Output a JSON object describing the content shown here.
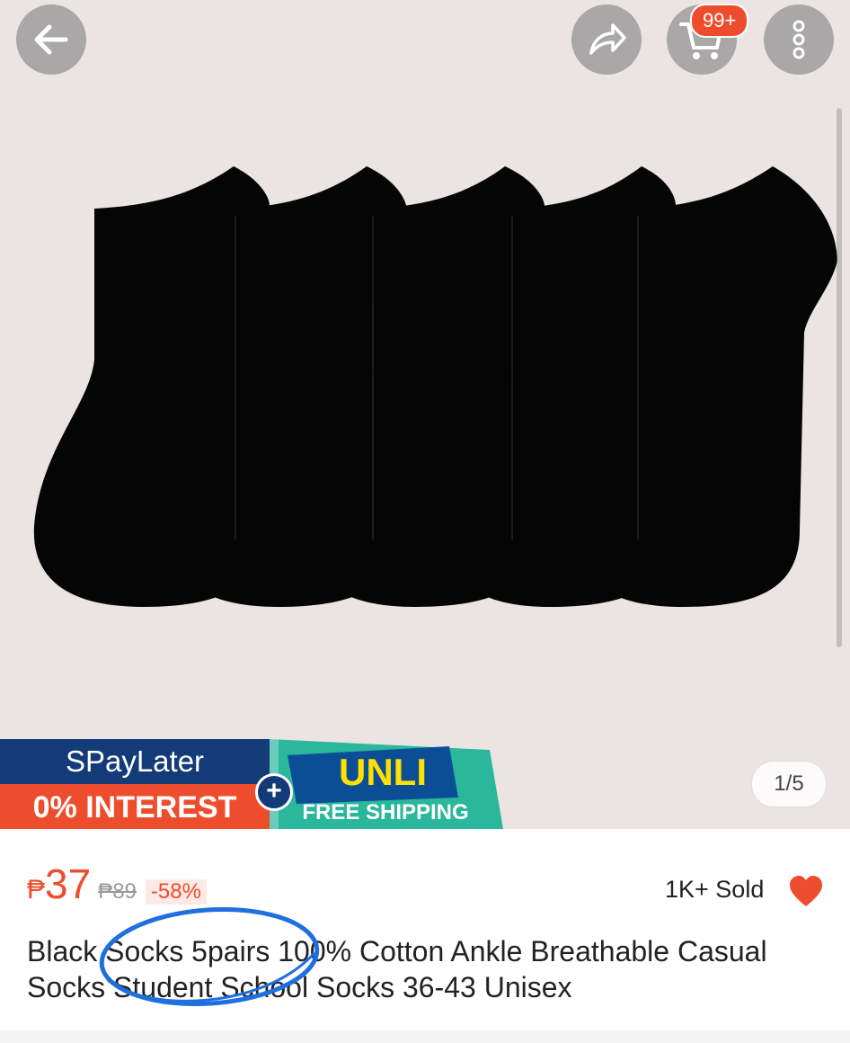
{
  "header": {
    "back_icon": "arrow-left-icon",
    "share_icon": "share-arrow-icon",
    "cart_icon": "shopping-cart-icon",
    "cart_badge": "99+",
    "more_icon": "more-vertical-icon"
  },
  "gallery": {
    "counter": "1/5",
    "image_subject": "five black ankle socks"
  },
  "banner": {
    "spaylater": "SPayLater",
    "interest": "0% INTEREST",
    "unli": "UNLI",
    "free_shipping": "FREE SHIPPING"
  },
  "product": {
    "currency": "₱",
    "price": "37",
    "original_price": "₱89",
    "discount": "-58%",
    "sold": "1K+ Sold",
    "title": "Black Socks 5pairs 100% Cotton Ankle Breathable Casual Socks Student School Socks 36-43 Unisex"
  },
  "colors": {
    "accent": "#ee4d2d",
    "banner_blue": "#123b77",
    "banner_teal": "#2ab79c",
    "annotation": "#1f6fe0"
  }
}
